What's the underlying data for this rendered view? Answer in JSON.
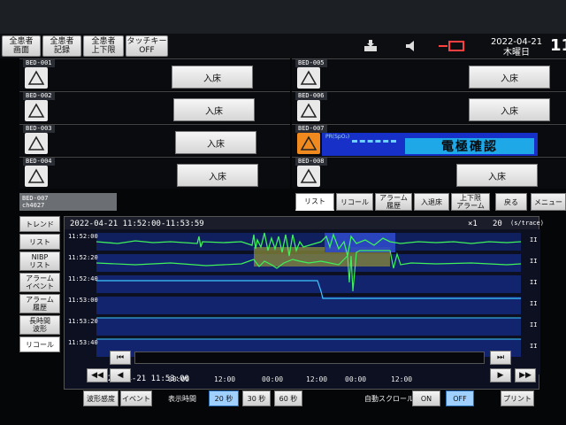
{
  "header": {
    "buttons": [
      {
        "label": "全患者\n画面"
      },
      {
        "label": "全患者\n記録"
      },
      {
        "label": "全患者\n上下限"
      },
      {
        "label": "タッチキー\nOFF"
      }
    ],
    "date": "2022-04-21",
    "weekday": "木曜日",
    "time_partial": "11",
    "icons": [
      "print-icon",
      "speaker-mute-icon",
      "telemetry-icon"
    ]
  },
  "beds": [
    {
      "name": "BED-001",
      "button": "入床"
    },
    {
      "name": "BED-002",
      "button": "入床"
    },
    {
      "name": "BED-003",
      "button": "入床"
    },
    {
      "name": "BED-004",
      "button": "入床"
    },
    {
      "name": "BED-005",
      "button": "入床"
    },
    {
      "name": "BED-006",
      "button": "入床"
    },
    {
      "name": "BED-007",
      "param_label": "PR(SpO₂)",
      "alert": "電極確認"
    },
    {
      "name": "BED-008",
      "button": "入床"
    }
  ],
  "selected_bed": {
    "name": "BED-007",
    "channel": "ch4027"
  },
  "tabs": [
    {
      "label": "リスト"
    },
    {
      "label": "リコール"
    },
    {
      "label": "アラーム\n履歴"
    },
    {
      "label": "入退床"
    },
    {
      "label": "上下限\nアラーム"
    },
    {
      "label": "戻る"
    },
    {
      "label": "メニュー"
    }
  ],
  "sidenav": [
    {
      "label": "トレンド"
    },
    {
      "label": "リスト"
    },
    {
      "label": "NIBP\nリスト"
    },
    {
      "label": "アラーム\nイベント"
    },
    {
      "label": "アラーム\n履歴"
    },
    {
      "label": "長時間\n波形"
    },
    {
      "label": "リコール"
    }
  ],
  "recall": {
    "window": "2022-04-21  11:52:00-11:53:59",
    "speed_prefix": "×1",
    "speed_value": "20",
    "speed_unit": "(s/trace)",
    "row_times": [
      "11:52:00",
      "11:52:20",
      "11:52:40",
      "11:53:00",
      "11:53:20",
      "11:53:40"
    ],
    "row_marker": "II",
    "footer_time": "2022-04-21  11:53:00"
  },
  "timeline": {
    "ticks": [
      "00:00",
      "12:00",
      "00:00",
      "12:00",
      "00:00",
      "12:00"
    ],
    "rewind_icon": "⏮",
    "end_icon": "⏭",
    "fast_back_icon": "◀◀",
    "back_icon": "◀",
    "forward_icon": "▶",
    "fast_forward_icon": "▶▶"
  },
  "bottom": {
    "waveform_print": "波形感度",
    "event": "イベント",
    "display_time_label": "表示時間",
    "times": [
      "20 秒",
      "30 秒",
      "60 秒"
    ],
    "selected_time": "20 秒",
    "autoscroll_label": "自動スクロール",
    "on": "ON",
    "off": "OFF",
    "print": "プリント"
  },
  "colors": {
    "trace_green": "#3ef05a",
    "trace_cyan": "#3cc8ff",
    "trace_bg": "#13246e",
    "highlight": "#8a8a3a",
    "alarm_orange": "#f08a1e"
  }
}
